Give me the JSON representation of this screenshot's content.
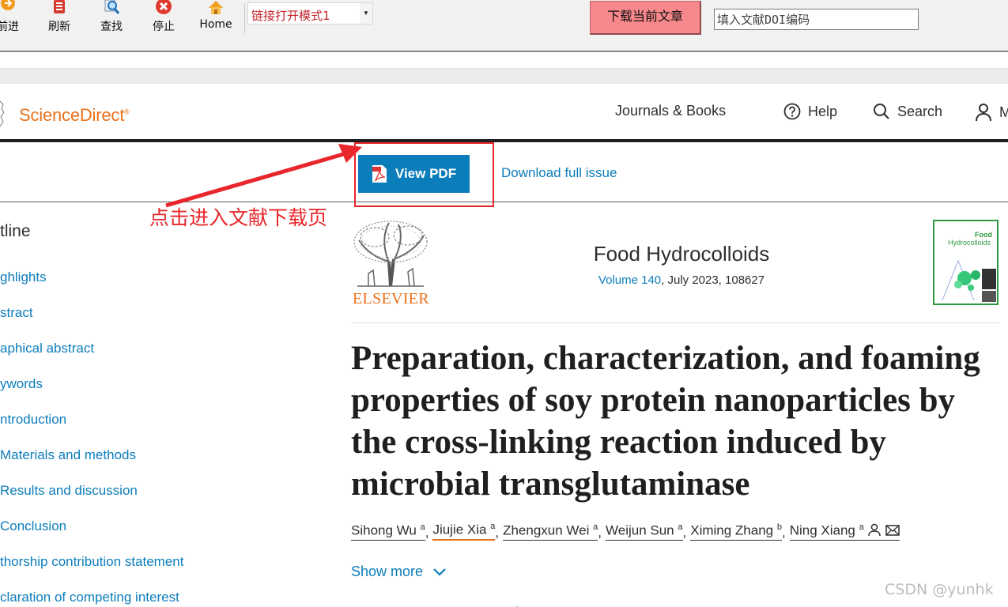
{
  "toolbar": {
    "buttons": [
      {
        "label": "前进",
        "icon": "forward-icon"
      },
      {
        "label": "刷新",
        "icon": "refresh-icon"
      },
      {
        "label": "查找",
        "icon": "find-icon"
      },
      {
        "label": "停止",
        "icon": "stop-icon"
      },
      {
        "label": "Home",
        "icon": "home-icon"
      }
    ],
    "mode_select_value": "链接打开模式1",
    "download_button": "下载当前文章",
    "doi_placeholder": "填入文献DOI编码"
  },
  "header": {
    "logo": "ScienceDirect",
    "nav": {
      "journals": "Journals & Books",
      "help": "Help",
      "search": "Search",
      "account": "M"
    }
  },
  "pdf_bar": {
    "view_pdf": "View PDF",
    "download_issue": "Download full issue"
  },
  "annotation": {
    "text": "点击进入文献下载页"
  },
  "outline": {
    "title": "tline",
    "items": [
      "ghlights",
      "stract",
      "aphical abstract",
      "ywords",
      "ntroduction",
      "Materials and methods",
      "Results and discussion",
      "Conclusion",
      "thorship contribution statement",
      "claration of competing interest"
    ]
  },
  "article": {
    "publisher": "ELSEVIER",
    "journal": "Food Hydrocolloids",
    "volume": "Volume 140",
    "issue_info": ", July 2023, 108627",
    "cover_title_1": "Food",
    "cover_title_2": "Hydrocolloids",
    "title": "Preparation, characterization, and foaming properties of soy protein nanoparticles by the cross-linking reaction induced by microbial transglutaminase",
    "authors": [
      {
        "name": "Sihong Wu",
        "aff": "a"
      },
      {
        "name": "Jiujie Xia",
        "aff": "a"
      },
      {
        "name": "Zhengxun Wei",
        "aff": "a"
      },
      {
        "name": "Weijun Sun",
        "aff": "a"
      },
      {
        "name": "Ximing Zhang",
        "aff": "b"
      },
      {
        "name": "Ning Xiang",
        "aff": "a"
      }
    ],
    "show_more": "Show more"
  },
  "watermark": "CSDN @yunhk",
  "colors": {
    "brand_orange": "#e9711c",
    "link_blue": "#0c7dbb",
    "annotation_red": "#e8262b",
    "download_pink": "#f7888b"
  }
}
